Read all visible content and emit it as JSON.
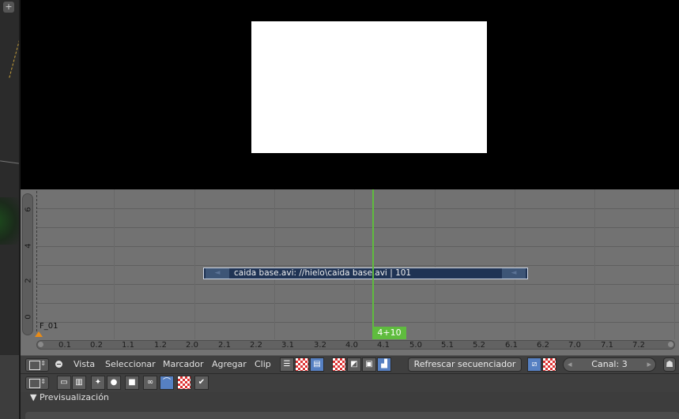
{
  "left_view": {
    "add_label": "+"
  },
  "sequencer": {
    "y_ticks": [
      "6",
      "4",
      "2",
      "0"
    ],
    "x_ticks": [
      "0.1",
      "0.2",
      "1.1",
      "1.2",
      "2.0",
      "2.1",
      "2.2",
      "3.1",
      "3.2",
      "4.0",
      "4.1",
      "5.0",
      "5.1",
      "5.2",
      "6.1",
      "6.2",
      "7.0",
      "7.1",
      "7.2"
    ],
    "marker_label": "F_01",
    "current_frame": "4+10",
    "strip": {
      "label": "caida base.avi: //hielo\\caida base.avi | 101",
      "left_handle": "◄",
      "right_handle": "◄",
      "color": "#1f3354"
    },
    "playhead_color": "#5fbc3e"
  },
  "header": {
    "menus": [
      "Vista",
      "Seleccionar",
      "Marcador",
      "Agregar",
      "Clip"
    ],
    "refresh_label": "Refrescar secuenciador",
    "channel_label": "Canal: 3",
    "channel_left": "◂",
    "channel_right": "▸"
  },
  "properties": {
    "panel_title": "Previsualización",
    "panel_arrow": "▼"
  }
}
